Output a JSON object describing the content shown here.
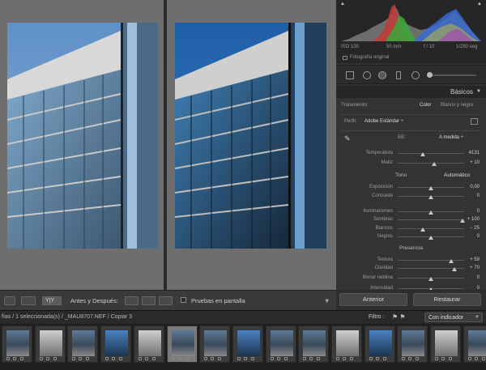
{
  "toolbar": {
    "before_after_label": "Antes y Después:",
    "proof_label": "Pruebas en pantalla",
    "yy_label": "Y|Y"
  },
  "histogram": {
    "iso": "ISO 100",
    "focal": "50 mm",
    "aperture": "f / 10",
    "shutter": "1/250 seg",
    "original_label": "Fotografía original"
  },
  "panel": {
    "title": "Básicos",
    "treatment_label": "Tratamiento:",
    "treatment_color": "Color",
    "treatment_bw": "Blanco y negro",
    "profile_label": "Perfil:",
    "profile_value": "Adobe Estándar ÷",
    "wb_label": "EB:",
    "wb_value": "A medida ÷",
    "tone_label": "Tono",
    "tone_auto": "Automático",
    "presence_label": "Presencia"
  },
  "sliders": [
    {
      "label": "Temperatura",
      "value": "4131",
      "pos": 0.38
    },
    {
      "label": "Matiz",
      "value": "+ 10",
      "pos": 0.55
    },
    {
      "label": "Exposición",
      "value": "0,00",
      "pos": 0.5
    },
    {
      "label": "Contraste",
      "value": "0",
      "pos": 0.5
    },
    {
      "label": "Iluminaciones",
      "value": "0",
      "pos": 0.5
    },
    {
      "label": "Sombras",
      "value": "+ 100",
      "pos": 0.98
    },
    {
      "label": "Blancos",
      "value": "− 25",
      "pos": 0.38
    },
    {
      "label": "Negros",
      "value": "0",
      "pos": 0.5
    },
    {
      "label": "Textura",
      "value": "+ 59",
      "pos": 0.8
    },
    {
      "label": "Claridad",
      "value": "+ 70",
      "pos": 0.85
    },
    {
      "label": "Bonar neblina",
      "value": "0",
      "pos": 0.5
    },
    {
      "label": "Intensidad",
      "value": "0",
      "pos": 0.5
    }
  ],
  "buttons": {
    "previous": "Anterior",
    "reset": "Restaurar"
  },
  "filmstrip_bar": {
    "path": "fías / 1 seleccionada(s) / _MAU8707.NEF / Copiar 3",
    "filter_label": "Filtro :",
    "filter_value": "Con indicador"
  },
  "filmstrip": {
    "count": 15,
    "selected_index": 5
  }
}
